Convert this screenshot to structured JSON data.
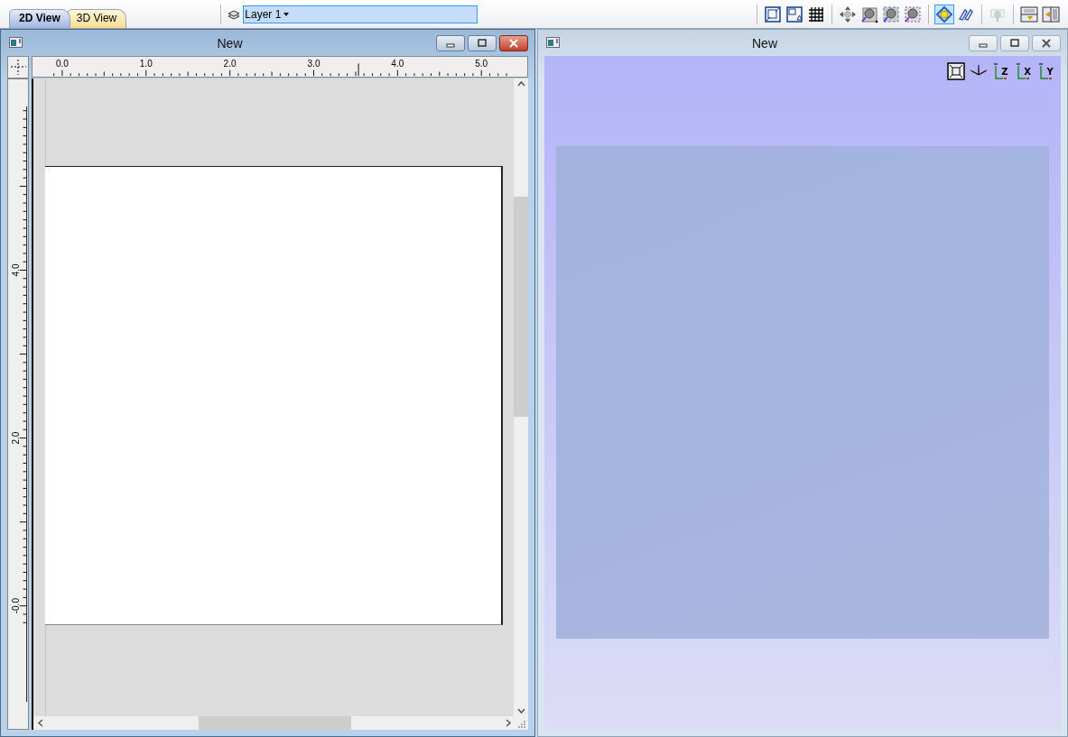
{
  "view_tabs": [
    {
      "label": "2D View",
      "selected": true,
      "kind": "plan"
    },
    {
      "label": "3D View",
      "selected": false,
      "kind": "perspective"
    }
  ],
  "layer_selector": {
    "value": "Layer 1"
  },
  "toolbar_groups": [
    [
      {
        "kind": "resize",
        "selected": false,
        "disabled": false
      },
      {
        "kind": "snap",
        "selected": false,
        "disabled": false
      },
      {
        "kind": "grid",
        "selected": false,
        "disabled": false
      }
    ],
    [
      {
        "kind": "pan",
        "selected": false,
        "disabled": false
      },
      {
        "kind": "zoom-extents",
        "selected": false,
        "disabled": false
      },
      {
        "kind": "zoom-fit",
        "selected": false,
        "disabled": false
      },
      {
        "kind": "zoom-window",
        "selected": false,
        "disabled": false
      }
    ],
    [
      {
        "kind": "render",
        "selected": true,
        "disabled": false
      },
      {
        "kind": "path",
        "selected": false,
        "disabled": false
      }
    ],
    [
      {
        "kind": "light",
        "selected": false,
        "disabled": true
      }
    ],
    [
      {
        "kind": "split-horizontal",
        "selected": false,
        "disabled": false
      },
      {
        "kind": "split-vertical",
        "selected": false,
        "disabled": false
      }
    ]
  ],
  "windows": [
    {
      "kind": "drawing",
      "title": "New",
      "active": true,
      "ruler": {
        "x_labels": [
          "0.0",
          "1.0",
          "2.0",
          "3.0",
          "4.0",
          "5.0"
        ],
        "y_labels": [
          "4.0",
          "2.0",
          "-0.0"
        ]
      }
    },
    {
      "kind": "scene",
      "title": "New",
      "active": false,
      "view_buttons": [
        {
          "kind": "fit"
        },
        {
          "kind": "iso"
        },
        {
          "kind": "axis",
          "label": "Z"
        },
        {
          "kind": "axis",
          "label": "X"
        },
        {
          "kind": "axis",
          "label": "Y"
        }
      ]
    }
  ]
}
